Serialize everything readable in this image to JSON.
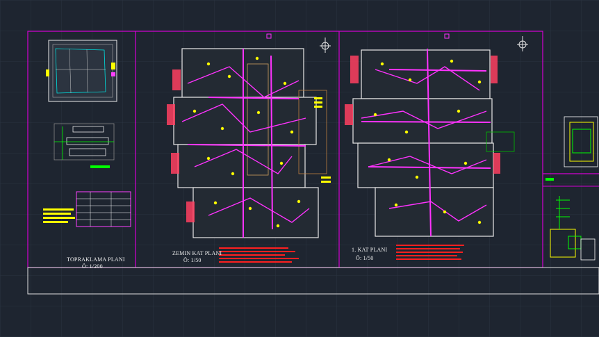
{
  "sheet": {
    "grid_color": "#2a3340",
    "frame_color": "#d400d4",
    "wall_color": "#e8e8e8",
    "wire_color": "#ff33ff",
    "fixture_color": "#ffff00",
    "note_color": "#ff2020"
  },
  "panels": [
    {
      "id": "grounding-plan",
      "title": "TOPRAKLAMA PLANI",
      "scale": "Ö: 1/200"
    },
    {
      "id": "ground-floor-plan",
      "title": "ZEMIN KAT PLANI",
      "scale": "Ö: 1/50"
    },
    {
      "id": "first-floor-plan",
      "title": "1. KAT PLANI",
      "scale": "Ö: 1/50"
    }
  ]
}
